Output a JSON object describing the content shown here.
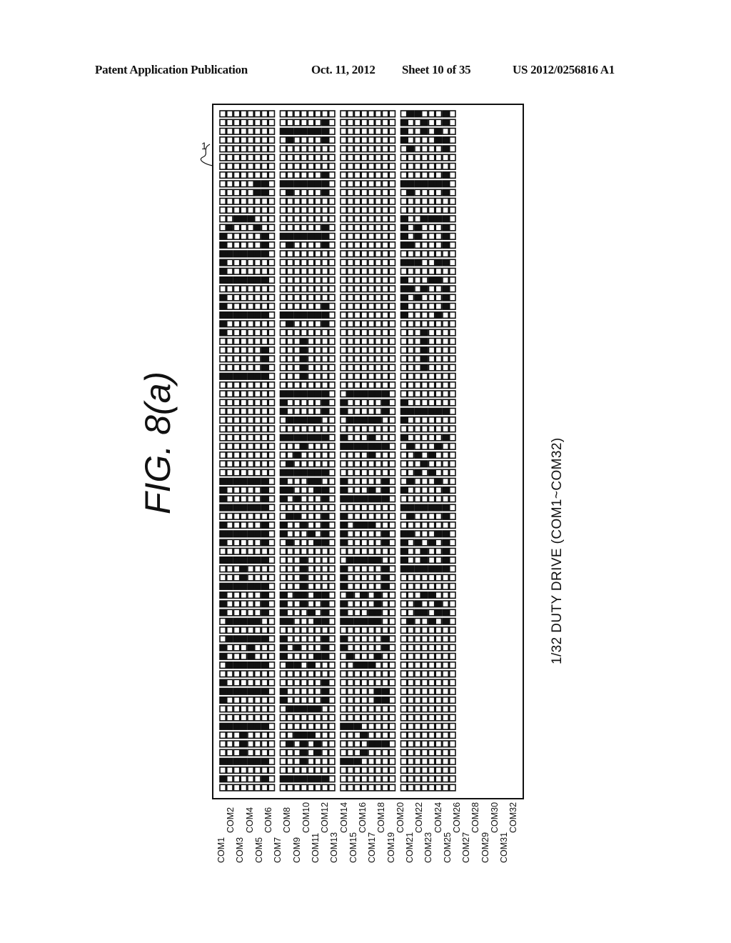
{
  "header": {
    "publication": "Patent Application Publication",
    "date": "Oct. 11, 2012",
    "sheet": "Sheet 10 of 35",
    "number": "US 2012/0256816 A1"
  },
  "figure": {
    "title": "FIG. 8(a)",
    "reference_numeral": "1",
    "caption": "1/32 DUTY DRIVE (COM1~COM32)"
  },
  "com_lines": [
    "COM1",
    "COM2",
    "COM3",
    "COM4",
    "COM5",
    "COM6",
    "COM7",
    "COM8",
    "COM9",
    "COM10",
    "COM11",
    "COM12",
    "COM13",
    "COM14",
    "COM15",
    "COM16",
    "COM17",
    "COM18",
    "COM19",
    "COM20",
    "COM21",
    "COM22",
    "COM23",
    "COM24",
    "COM25",
    "COM26",
    "COM27",
    "COM28",
    "COM29",
    "COM30",
    "COM31",
    "COM32"
  ],
  "dot_matrix": {
    "groups": 4,
    "columns_per_group": 8,
    "row_count": 78,
    "on_color": "#111111",
    "off_color": "#ffffff",
    "rows": [
      "00000000|00000000|00000000|01100010",
      "00000000|00000010|00000000|10010010",
      "00000000|11111110|00000000|10010100",
      "00000000|01000010|00000000|10000110",
      "00000000|00000000|00000000|01000010",
      "00000000|00000000|00000000|00000000",
      "00000000|00000000|00000000|00000000",
      "00000000|00000010|00000000|00000010",
      "00000110|11111110|00000000|11111110",
      "00000110|01000010|00000000|01000010",
      "00000000|00000000|00000000|00000000",
      "00000000|00000000|00000000|00000000",
      "00111000|00000000|00000000|10011110",
      "01000100|00000010|00000000|10100010",
      "10000010|11111110|00000000|10100010",
      "10000010|01000010|00000000|11000010",
      "11111110|00000000|00000000|00000000",
      "10000000|00000000|00000000|11100110",
      "10000000|00000000|00000000|00000000",
      "11111110|00000000|00000000|10001100",
      "00000000|00000000|00000000|11010010",
      "10000000|00000000|00000000|10100010",
      "10000000|00000010|00000000|10000010",
      "11111110|11111110|00000000|10000100",
      "10000000|01000010|00000000|00000000",
      "10000000|00000000|00000000|00010000",
      "00000000|00010000|00000000|00010000",
      "00000010|00010000|00000000|00010000",
      "00000010|00010000|00000000|00010000",
      "00000010|00010000|00000000|00010000",
      "11111110|00010000|00000000|00000000",
      "00000000|00000000|00000000|00000000",
      "00000000|11111110|01111110|00000000",
      "00000000|10000010|10000010|10000000",
      "00000000|10000010|10000010|11111110",
      "00000000|01111100|01111100|10000000",
      "00000000|00000000|00000000|00000000",
      "00000000|11111110|10001000|10000010",
      "00000000|00010000|11111110|01000100",
      "00000000|00100000|00001000|00101000",
      "00000000|01000000|00000000|00010000",
      "00000000|11111110|00000000|00101000",
      "11111110|10001100|10000010|01000100",
      "10000010|11000110|10001010|10000010",
      "10000010|10100010|11111110|00000000",
      "11111110|00000000|00000000|11111110",
      "00000000|01100010|10000000|01000010",
      "10000010|10010010|10111000|00000000",
      "11111110|10001010|10000010|11000110",
      "10000010|01000110|10000010|10101010",
      "00000000|00000000|00000000|10010010",
      "11111110|00010000|01111100|10010010",
      "00010000|00010000|10000010|11111110",
      "00010000|00010000|10000010|00000000",
      "11111110|00010000|10000010|00000000",
      "10000010|10110110|01010100|00011000",
      "10000010|10010010|10000100|00100100",
      "10000010|10001010|10001100|00110110",
      "01111100|11000110|11111100|01001010",
      "00000000|00000000|00000000|00000000",
      "01111110|10000010|10000010|00000000",
      "10001000|10100010|10000010|00000000",
      "10001000|10000110|01000100|00000000",
      "01111110|01101000|00111000|00000000",
      "00000000|00000000|00000000|00000000",
      "10000000|00000010|00000000|00000000",
      "11111110|10000010|00000110|00000000",
      "10000000|10000010|00000110|00000000",
      "00000000|01111100|00000000|00000000",
      "00000000|00000000|00000000|00000000",
      "11111110|00000000|11100000|00000000",
      "00010000|00111000|00010000|00000000",
      "00010000|01010100|00001110|00000000",
      "00010000|00010100|00010000|00000000",
      "11111110|00010000|11100000|00000000",
      "00000000|00000000|00000000|00000000",
      "10000010|11111110|00000000|00000000",
      "00000000|00000000|00000000|00000000"
    ]
  }
}
